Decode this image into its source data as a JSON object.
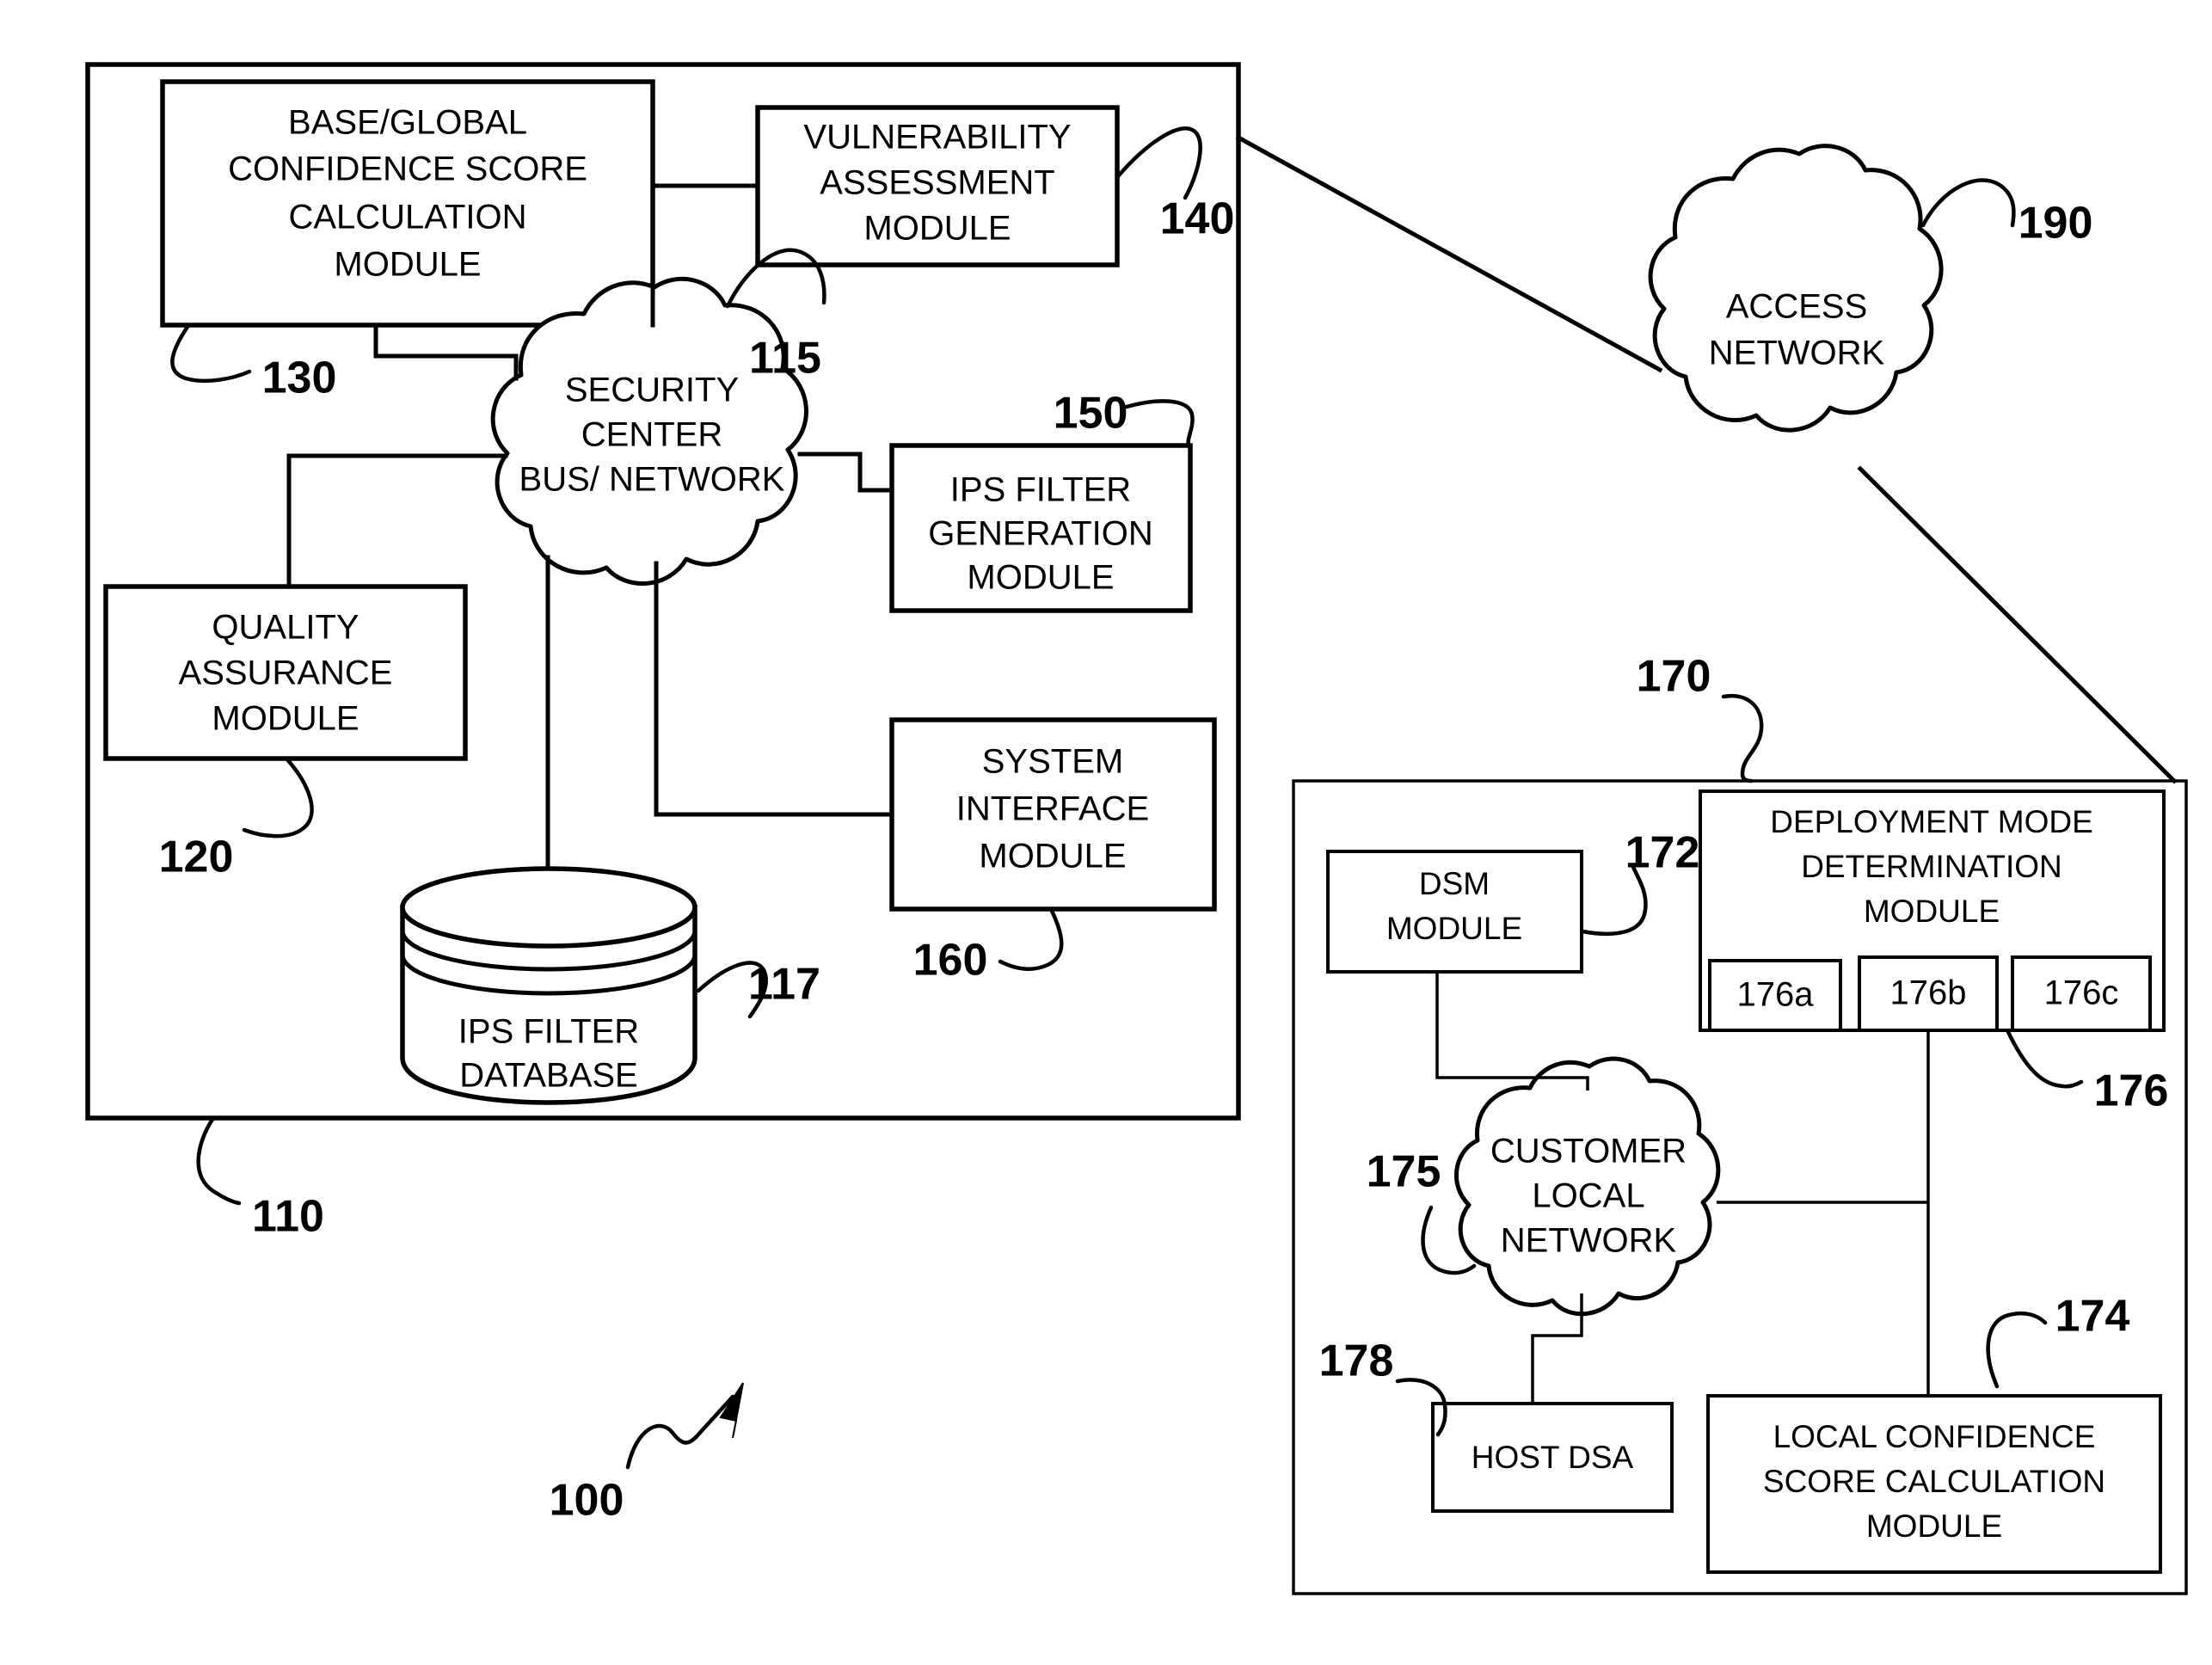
{
  "figure": {
    "title": "Network security system block diagram",
    "figure_ref": "100",
    "line_color": "#000000",
    "background_color": "#ffffff"
  },
  "panels": {
    "security_center": {
      "ref": "110",
      "bus_ref": "115",
      "bus_label_line1": "SECURITY",
      "bus_label_line2": "CENTER",
      "bus_label_line3": "BUS/ NETWORK"
    },
    "customer_site": {
      "ref": "170"
    }
  },
  "modules": {
    "base_global": {
      "ref": "130",
      "line1": "BASE/GLOBAL",
      "line2": "CONFIDENCE SCORE",
      "line3": "CALCULATION",
      "line4": "MODULE"
    },
    "vulnerability": {
      "ref": "140",
      "line1": "VULNERABILITY",
      "line2": "ASSESSMENT",
      "line3": "MODULE"
    },
    "ips_filter_generation": {
      "ref": "150",
      "line1": "IPS FILTER",
      "line2": "GENERATION",
      "line3": "MODULE"
    },
    "system_interface": {
      "ref": "160",
      "line1": "SYSTEM",
      "line2": "INTERFACE",
      "line3": "MODULE"
    },
    "quality_assurance": {
      "ref": "120",
      "line1": "QUALITY",
      "line2": "ASSURANCE",
      "line3": "MODULE"
    },
    "ips_filter_database": {
      "ref": "117",
      "line1": "IPS FILTER",
      "line2": "DATABASE"
    },
    "access_network": {
      "ref": "190",
      "line1": "ACCESS",
      "line2": "NETWORK"
    },
    "dsm": {
      "ref": "172",
      "line1": "DSM",
      "line2": "MODULE"
    },
    "deployment_mode": {
      "ref": "176",
      "line1": "DEPLOYMENT MODE",
      "line2": "DETERMINATION",
      "line3": "MODULE",
      "sub_modules": [
        {
          "label": "176a"
        },
        {
          "label": "176b"
        },
        {
          "label": "176c"
        }
      ]
    },
    "customer_local_network": {
      "ref": "175",
      "line1": "CUSTOMER",
      "line2": "LOCAL",
      "line3": "NETWORK"
    },
    "host_dsa": {
      "ref": "178",
      "line1": "HOST DSA"
    },
    "local_confidence": {
      "ref": "174",
      "line1": "LOCAL CONFIDENCE",
      "line2": "SCORE CALCULATION",
      "line3": "MODULE"
    }
  }
}
